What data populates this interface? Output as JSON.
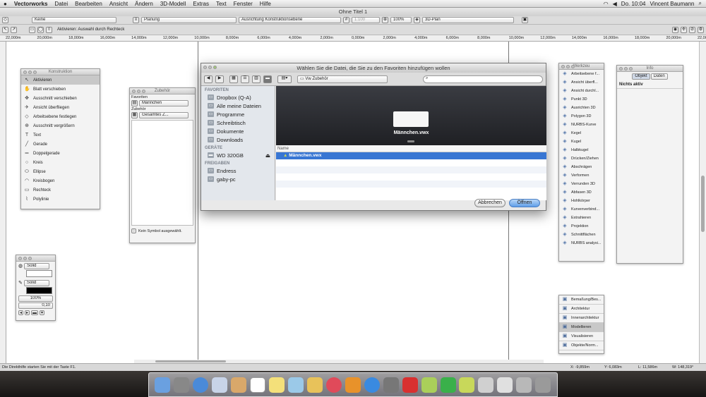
{
  "menubar": {
    "app": "Vectorworks",
    "items": [
      "Datei",
      "Bearbeiten",
      "Ansicht",
      "Ändern",
      "3D-Modell",
      "Extras",
      "Text",
      "Fenster",
      "Hilfe"
    ],
    "clock": "Do. 10:04",
    "user": "Vincent Baumann"
  },
  "window": {
    "title": "Ohne Titel 1"
  },
  "toolbar1": {
    "klasse": "Keine",
    "ebene": "Planung",
    "ausrichtung": "Ausrichtung Konstruktionsebene",
    "massstab": "1:100",
    "zoom": "100%",
    "ansicht": "3D-Plan"
  },
  "toolbar2": {
    "hint": "Aktivieren: Auswahl durch Rechteck"
  },
  "ruler": {
    "ticks": [
      "22,000m",
      "20,000m",
      "18,000m",
      "16,000m",
      "14,000m",
      "12,000m",
      "10,000m",
      "8,000m",
      "6,000m",
      "4,000m",
      "2,000m",
      "0,000m",
      "2,000m",
      "4,000m",
      "6,000m",
      "8,000m",
      "10,000m",
      "12,000m",
      "14,000m",
      "16,000m",
      "18,000m",
      "20,000m",
      "22,000m"
    ]
  },
  "konstruktion": {
    "title": "Konstruktion",
    "tools": [
      {
        "label": "Aktivieren",
        "icon": "arrow-icon"
      },
      {
        "label": "Blatt verschieben",
        "icon": "hand-icon"
      },
      {
        "label": "Ausschnitt verschieben",
        "icon": "move-icon"
      },
      {
        "label": "Ansicht überfliegen",
        "icon": "flyover-icon"
      },
      {
        "label": "Arbeitsebene festlegen",
        "icon": "plane-icon"
      },
      {
        "label": "Ausschnitt vergrößern",
        "icon": "zoom-icon"
      },
      {
        "label": "Text",
        "icon": "text-icon"
      },
      {
        "label": "Gerade",
        "icon": "line-icon"
      },
      {
        "label": "Doppelgerade",
        "icon": "double-line-icon"
      },
      {
        "label": "Kreis",
        "icon": "circle-icon"
      },
      {
        "label": "Ellipse",
        "icon": "ellipse-icon"
      },
      {
        "label": "Kreisbogen",
        "icon": "arc-icon"
      },
      {
        "label": "Rechteck",
        "icon": "rectangle-icon"
      },
      {
        "label": "Polylinie",
        "icon": "polyline-icon"
      }
    ]
  },
  "zubehoer": {
    "title": "Zubehör",
    "favoriten_label": "Favoriten",
    "favoriten_value": "Männchen",
    "zubehoer_label": "Zubehör",
    "zubehoer_value": "Gesamtes Z...",
    "status": "Kein Symbol ausgewählt."
  },
  "attributes": {
    "fill": "Solid",
    "pen": "Solid",
    "opacity": "100%",
    "line": "0,10"
  },
  "werkzeug": {
    "title": "Werkzeu",
    "tools": [
      "Arbeitsebene f...",
      "Ansicht überfl...",
      "Ansicht durchl...",
      "Punkt 3D",
      "Ausrichten 3D",
      "Polygon 3D",
      "NURBS-Kurve",
      "Kegel",
      "Kugel",
      "Halbkugel",
      "Drücken/Ziehen",
      "Abschrägen",
      "Verformen",
      "Verrunden 3D",
      "Abfasen 3D",
      "Hohlkörper",
      "Kurvenverbind...",
      "Extrahieren",
      "Projektion",
      "Schnittflächen",
      "NURBS analysi..."
    ],
    "sets": [
      {
        "label": "Bemaßung/Bes..."
      },
      {
        "label": "Architektur"
      },
      {
        "label": "Innenarchitektur"
      },
      {
        "label": "Modellieren",
        "selected": true
      },
      {
        "label": "Visualisieren"
      },
      {
        "label": "Objekte/Norm..."
      }
    ]
  },
  "info": {
    "title": "Info",
    "tab_objekt": "Objekt",
    "tab_daten": "Daten",
    "status": "Nichts aktiv"
  },
  "dialog": {
    "title": "Wählen Sie die Datei, die Sie zu den Favoriten hinzufügen wollen",
    "location": "Vw Zubehör",
    "preview_name": "Männchen.vwx",
    "column_name": "Name",
    "files": [
      "Männchen.vwx"
    ],
    "sidebar": {
      "favoriten_header": "FAVORITEN",
      "favoriten": [
        "Dropbox (Q-A)",
        "Alle meine Dateien",
        "Programme",
        "Schreibtisch",
        "Dokumente",
        "Downloads"
      ],
      "geraete_header": "GERÄTE",
      "geraete": [
        "WD 320GB"
      ],
      "freigaben_header": "FREIGABEN",
      "freigaben": [
        "Endress",
        "gaby-pc"
      ]
    },
    "cancel": "Abbrechen",
    "open": "Öffnen"
  },
  "statusbar": {
    "hint": "Die Direkthilfe starten Sie mit der Taste F1.",
    "x": "X: -9,859m",
    "y": "Y: 6,083m",
    "l": "L: 11,586m",
    "w": "W: 148,319°"
  },
  "colors": {
    "selection": "#3876d3",
    "desktop": "#2a2624"
  }
}
